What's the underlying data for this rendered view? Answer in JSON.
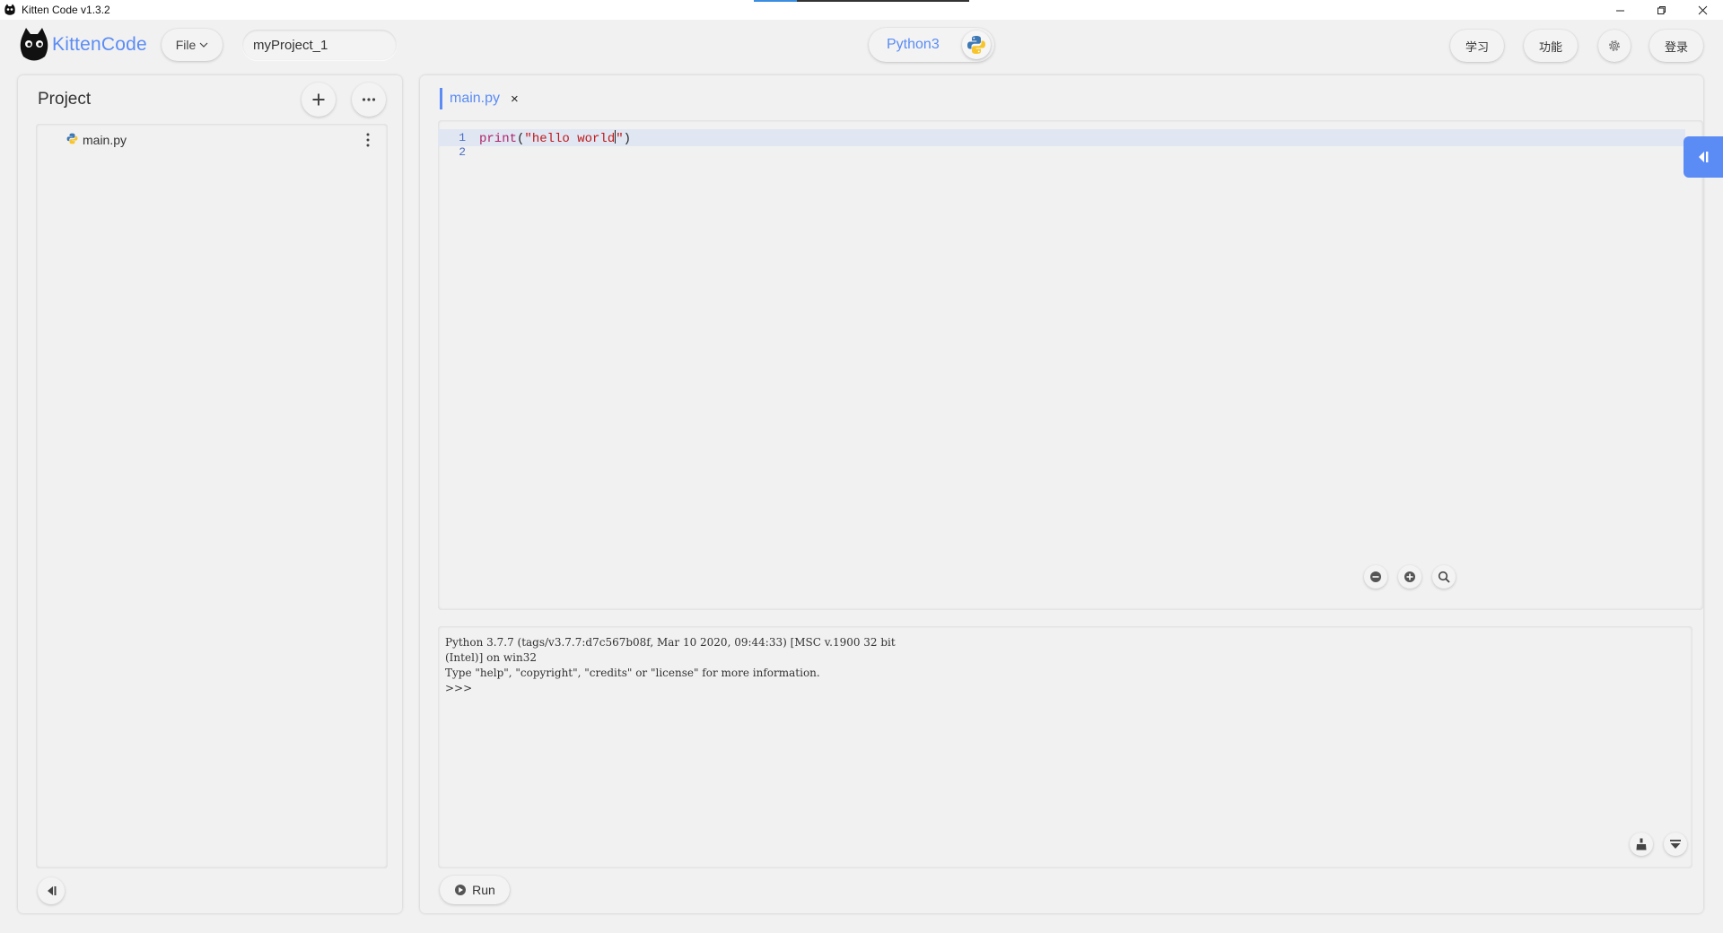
{
  "window": {
    "title": "Kitten Code v1.3.2",
    "controls": {
      "minimize": "—",
      "restore": "❐",
      "close": "✕"
    }
  },
  "toolbar": {
    "logo_text": "KittenCode",
    "file_label": "File",
    "project_name": "myProject_1",
    "language": "Python3",
    "learn_label": "学习",
    "features_label": "功能",
    "login_label": "登录"
  },
  "project_panel": {
    "title": "Project",
    "files": [
      {
        "name": "main.py",
        "icon": "python-file-icon"
      }
    ]
  },
  "editor": {
    "tab_label": "main.py",
    "tab_close": "×",
    "lines": [
      {
        "number": "1",
        "fn": "print",
        "open": "(",
        "str_before_cursor": "\"hello world",
        "str_after_cursor": "\"",
        "close": ")"
      },
      {
        "number": "2"
      }
    ]
  },
  "console": {
    "output": "Python 3.7.7 (tags/v3.7.7:d7c567b08f, Mar 10 2020, 09:44:33) [MSC v.1900 32 bit\n(Intel)] on win32\nType \"help\", \"copyright\", \"credits\" or \"license\" for more information.\n>>>"
  },
  "run": {
    "label": "Run"
  },
  "colors": {
    "accent": "#5b8cf5",
    "background": "#f1f1f1",
    "active_line": "#e0e6f2",
    "keyword": "#b0246a",
    "string": "#c01818"
  }
}
